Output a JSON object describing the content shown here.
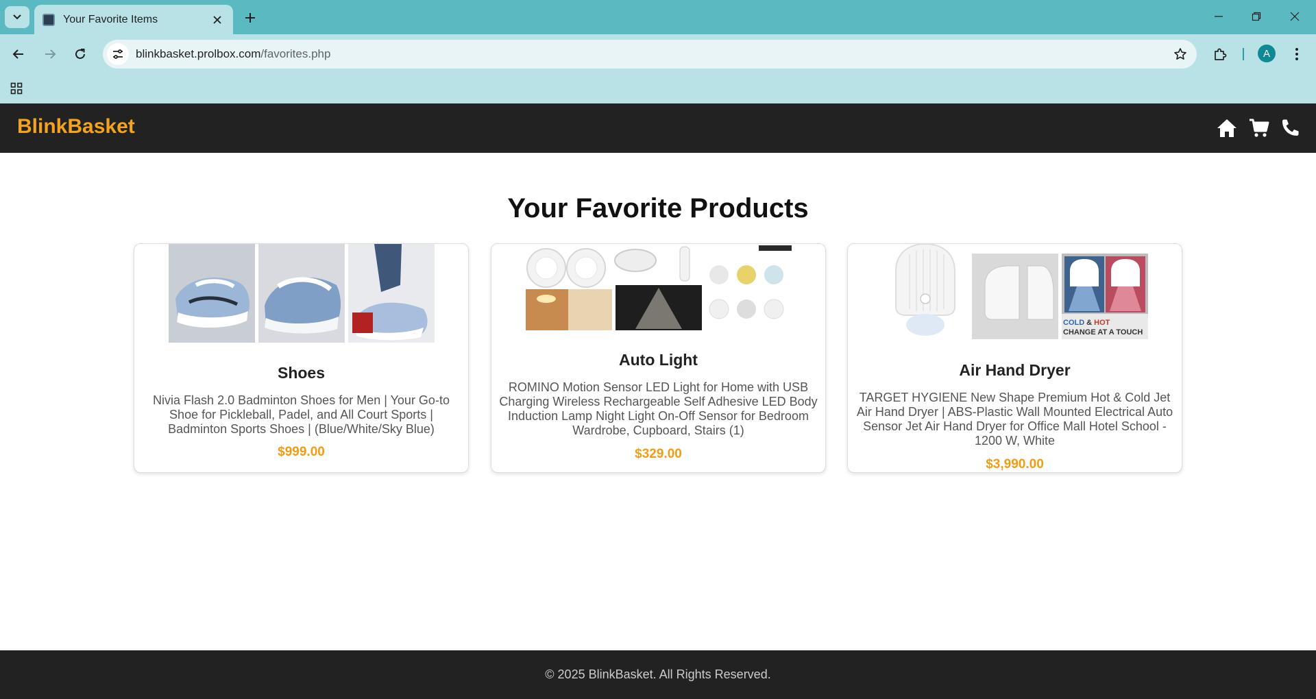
{
  "browser": {
    "tab_title": "Your Favorite Items",
    "url_host": "blinkbasket.prolbox.com",
    "url_path": "/favorites.php",
    "profile_initial": "A"
  },
  "site": {
    "brand": "BlinkBasket",
    "nav_icons": [
      "home-icon",
      "cart-icon",
      "phone-icon"
    ],
    "accent_color": "#f5a31a",
    "header_bg": "#222222"
  },
  "page": {
    "title": "Your Favorite Products"
  },
  "products": [
    {
      "name": "Shoes",
      "description": "Nivia Flash 2.0 Badminton Shoes for Men | Your Go-to Shoe for Pickleball, Padel, and All Court Sports | Badminton Sports Shoes | (Blue/White/Sky Blue)",
      "price": "$999.00"
    },
    {
      "name": "Auto Light",
      "description": "ROMINO Motion Sensor LED Light for Home with USB Charging Wireless Rechargeable Self Adhesive LED Body Induction Lamp Night Light On-Off Sensor for Bedroom Wardrobe, Cupboard, Stairs (1)",
      "price": "$329.00"
    },
    {
      "name": "Air Hand Dryer",
      "description": "TARGET HYGIENE New Shape Premium Hot & Cold Jet Air Hand Dryer | ABS-Plastic Wall Mounted Electrical Auto Sensor Jet Air Hand Dryer for Office Mall Hotel School - 1200 W, White",
      "price": "$3,990.00",
      "image_caption_line1_a": "COLD",
      "image_caption_line1_b": "&",
      "image_caption_line1_c": "HOT",
      "image_caption_line2": "CHANGE AT A TOUCH"
    }
  ],
  "footer": {
    "copyright": "© 2025 BlinkBasket. All Rights Reserved."
  }
}
